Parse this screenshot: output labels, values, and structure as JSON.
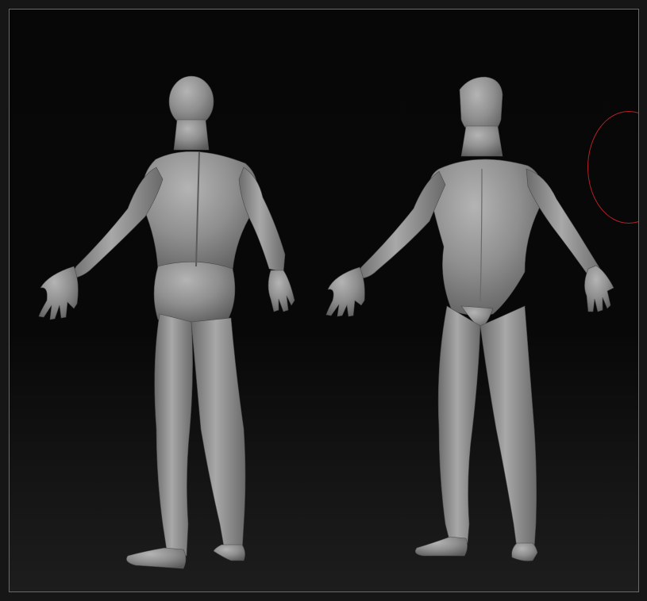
{
  "viewport": {
    "background_color": "#070707",
    "frame_color": "#6a6a6a",
    "model_color": "#8e8e8e",
    "gizmo_color": "#b3202a"
  },
  "models": [
    {
      "name": "back-view",
      "icon": "human-figure-back"
    },
    {
      "name": "front-view",
      "icon": "human-figure-front"
    }
  ]
}
